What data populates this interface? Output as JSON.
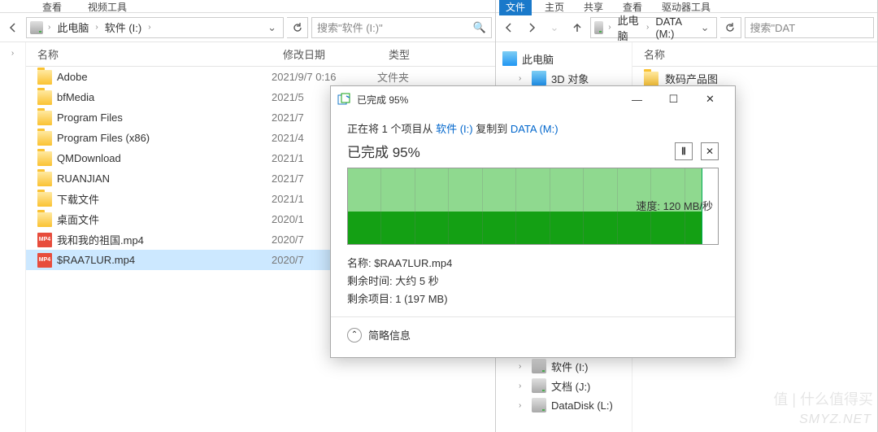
{
  "left": {
    "ribbon": {
      "t1": "查看",
      "t2": "视频工具"
    },
    "breadcrumb": {
      "pc": "此电脑",
      "drive": "软件 (I:)"
    },
    "search_placeholder": "搜索\"软件 (I:)\"",
    "headers": {
      "name": "名称",
      "date": "修改日期",
      "type": "类型"
    },
    "rows": [
      {
        "icon": "folder",
        "name": "Adobe",
        "date": "2021/9/7 0:16",
        "type": "文件夹"
      },
      {
        "icon": "folder",
        "name": "bfMedia",
        "date": "2021/5",
        "type": ""
      },
      {
        "icon": "folder",
        "name": "Program Files",
        "date": "2021/7",
        "type": ""
      },
      {
        "icon": "folder",
        "name": "Program Files (x86)",
        "date": "2021/4",
        "type": ""
      },
      {
        "icon": "folder",
        "name": "QMDownload",
        "date": "2021/1",
        "type": ""
      },
      {
        "icon": "folder",
        "name": "RUANJIAN",
        "date": "2021/7",
        "type": ""
      },
      {
        "icon": "folder",
        "name": "下载文件",
        "date": "2021/1",
        "type": ""
      },
      {
        "icon": "folder",
        "name": "桌面文件",
        "date": "2020/1",
        "type": ""
      },
      {
        "icon": "mp4",
        "name": "我和我的祖国.mp4",
        "date": "2020/7",
        "type": ""
      },
      {
        "icon": "mp4",
        "name": "$RAA7LUR.mp4",
        "date": "2020/7",
        "type": "",
        "selected": true
      }
    ]
  },
  "right": {
    "ribbon": {
      "t0": "文件",
      "t1": "主页",
      "t2": "共享",
      "t3": "查看",
      "t4": "驱动器工具"
    },
    "breadcrumb": {
      "pc": "此电脑",
      "drive": "DATA (M:)"
    },
    "search_placeholder": "搜索\"DAT",
    "tree": {
      "root": "此电脑",
      "children": [
        {
          "icon": "3d",
          "label": "3D 对象"
        },
        {
          "icon": "drive",
          "label": "软件 (I:)"
        },
        {
          "icon": "drive",
          "label": "文档 (J:)"
        },
        {
          "icon": "drive",
          "label": "DataDisk (L:)"
        }
      ]
    },
    "headers": {
      "name": "名称"
    },
    "rows": [
      {
        "icon": "folder",
        "name": "数码产品图"
      }
    ]
  },
  "dialog": {
    "title": "已完成 95%",
    "copy_prefix": "正在将 1 个项目从 ",
    "copy_src": "软件 (I:)",
    "copy_mid": " 复制到 ",
    "copy_dst": "DATA (M:)",
    "status": "已完成 95%",
    "speed": "速度: 120 MB/秒",
    "name_lbl": "名称: ",
    "name_val": "$RAA7LUR.mp4",
    "remain_time_lbl": "剩余时间: ",
    "remain_time_val": "大约 5 秒",
    "remain_items_lbl": "剩余项目: ",
    "remain_items_val": "1 (197 MB)",
    "less_info": "简略信息"
  },
  "watermark": "SMYZ.NET",
  "watermark2": "值 | 什么值得买"
}
